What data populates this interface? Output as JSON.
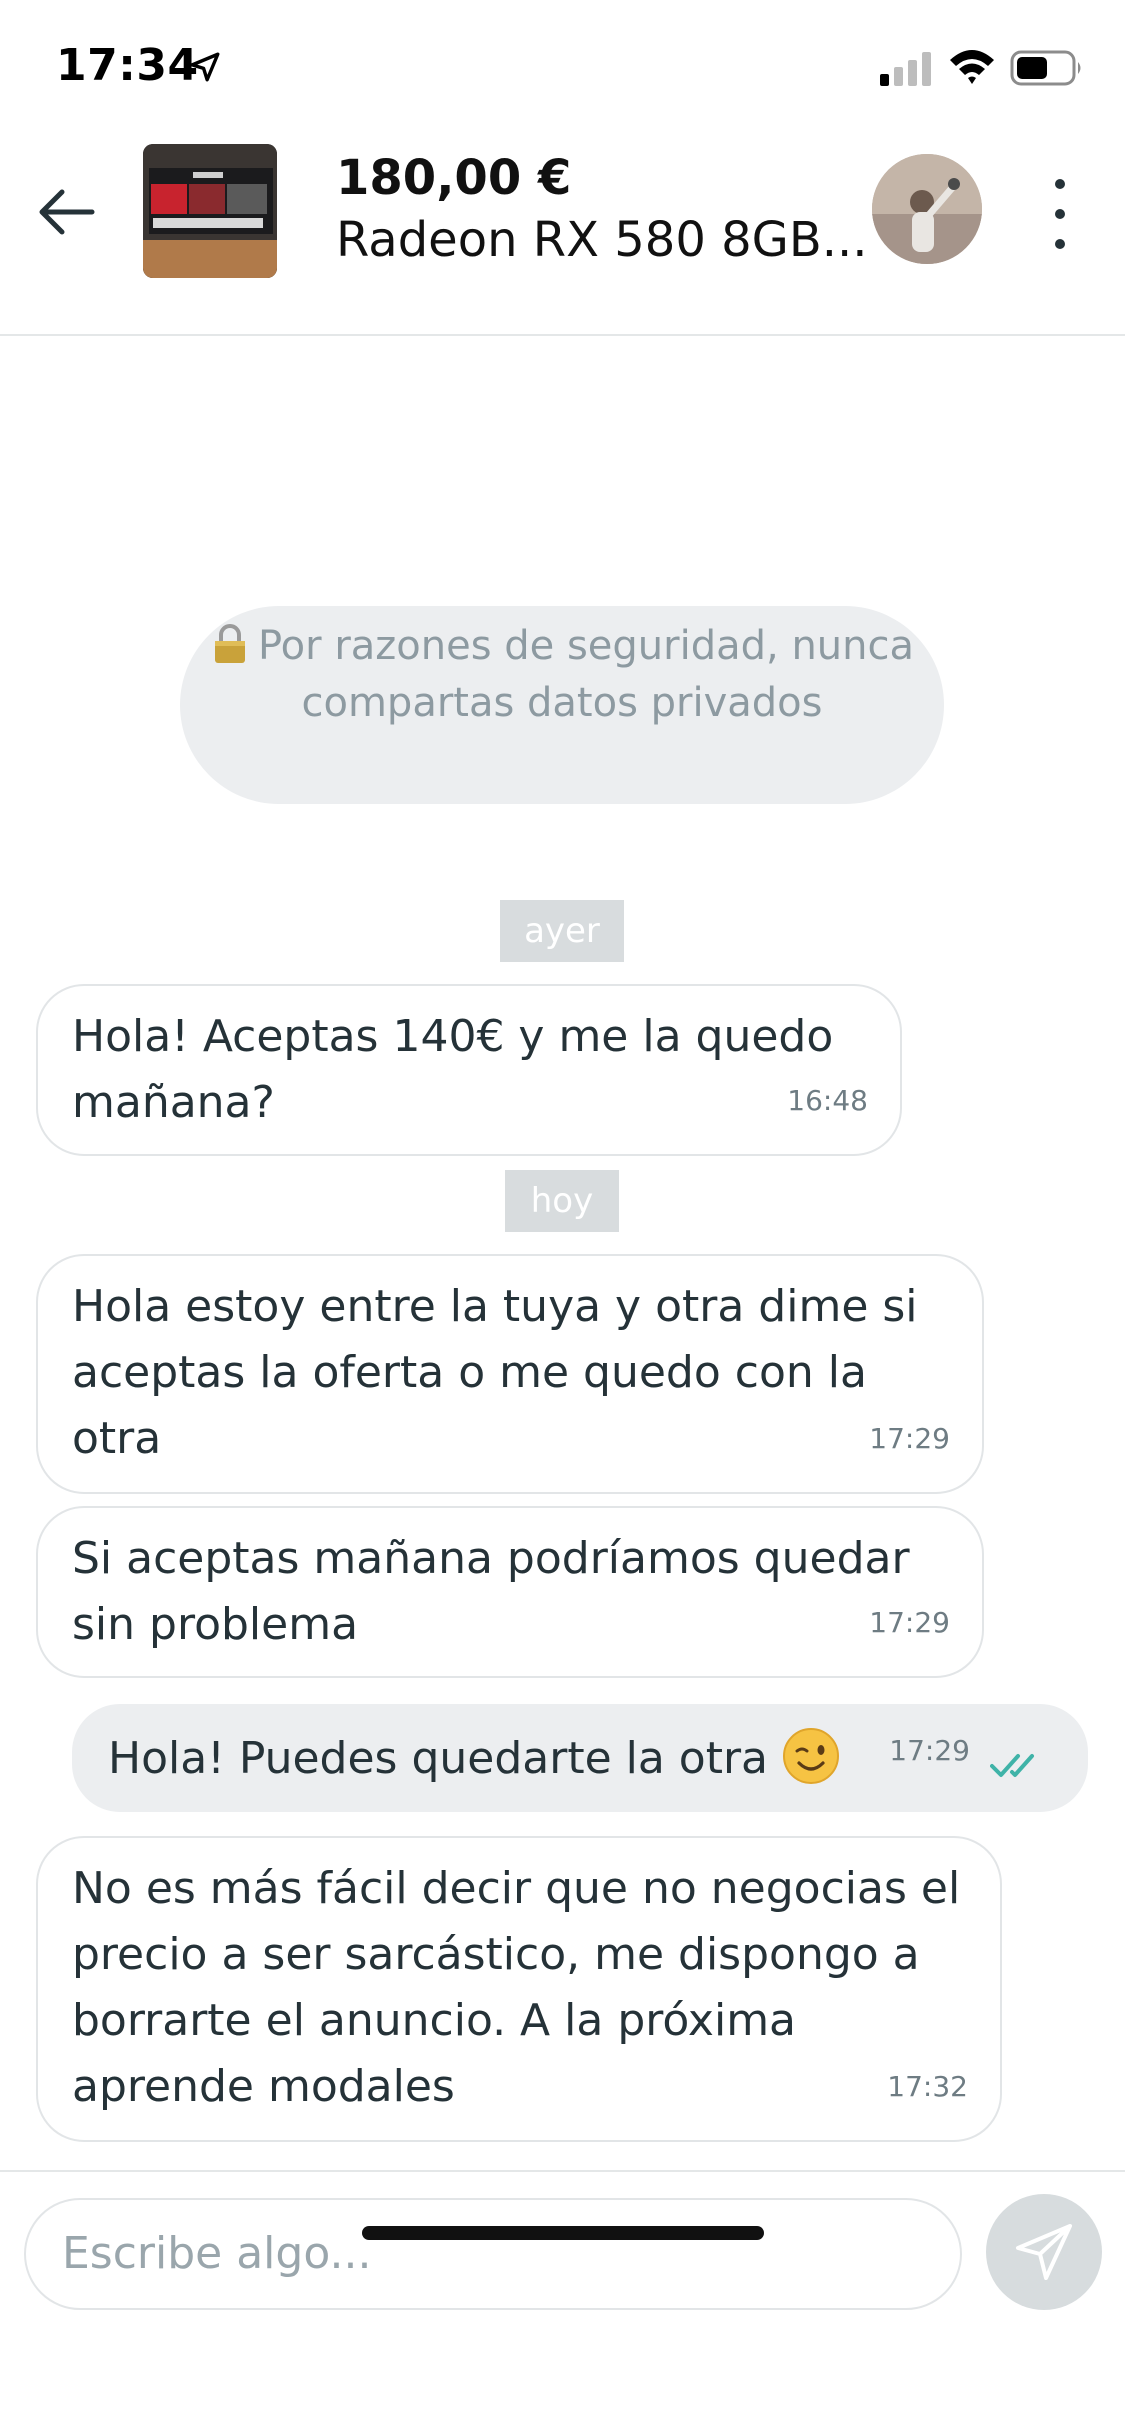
{
  "status_bar": {
    "time": "17:34",
    "icons": [
      "location-arrow-icon",
      "cellular-signal-icon",
      "wifi-icon",
      "battery-icon"
    ]
  },
  "header": {
    "price": "180,00 €",
    "product_title": "Radeon RX 580 8GB...",
    "icons": [
      "back-arrow-icon",
      "more-vertical-icon"
    ]
  },
  "security_notice": {
    "icon": "lock-icon",
    "text": "Por razones de seguridad, nunca compartas datos privados"
  },
  "conversation": {
    "date_ayer": "ayer",
    "date_hoy": "hoy",
    "messages": [
      {
        "from": "other",
        "text": "Hola! Aceptas 140€ y me la quedo mañana?",
        "time": "16:48"
      },
      {
        "from": "other",
        "text": "Hola estoy entre la tuya y otra dime si aceptas la oferta o me quedo con la otra",
        "time": "17:29"
      },
      {
        "from": "other",
        "text": "Si aceptas mañana podríamos quedar sin problema",
        "time": "17:29"
      },
      {
        "from": "me",
        "text": "Hola! Puedes quedarte la otra",
        "emoji": "winking-face-emoji",
        "time": "17:29",
        "status_icon": "double-check-icon"
      },
      {
        "from": "other",
        "text": "No es más fácil decir que no negocias el precio a ser sarcástico, me dispongo a borrarte el anuncio. A la próxima aprende modales",
        "time": "17:32"
      }
    ]
  },
  "compose": {
    "placeholder": "Escribe algo...",
    "send_icon": "send-icon"
  },
  "colors": {
    "read_check": "#3fb3a8",
    "bubble_border": "#e2e5e7",
    "me_bubble": "#eceef0"
  }
}
